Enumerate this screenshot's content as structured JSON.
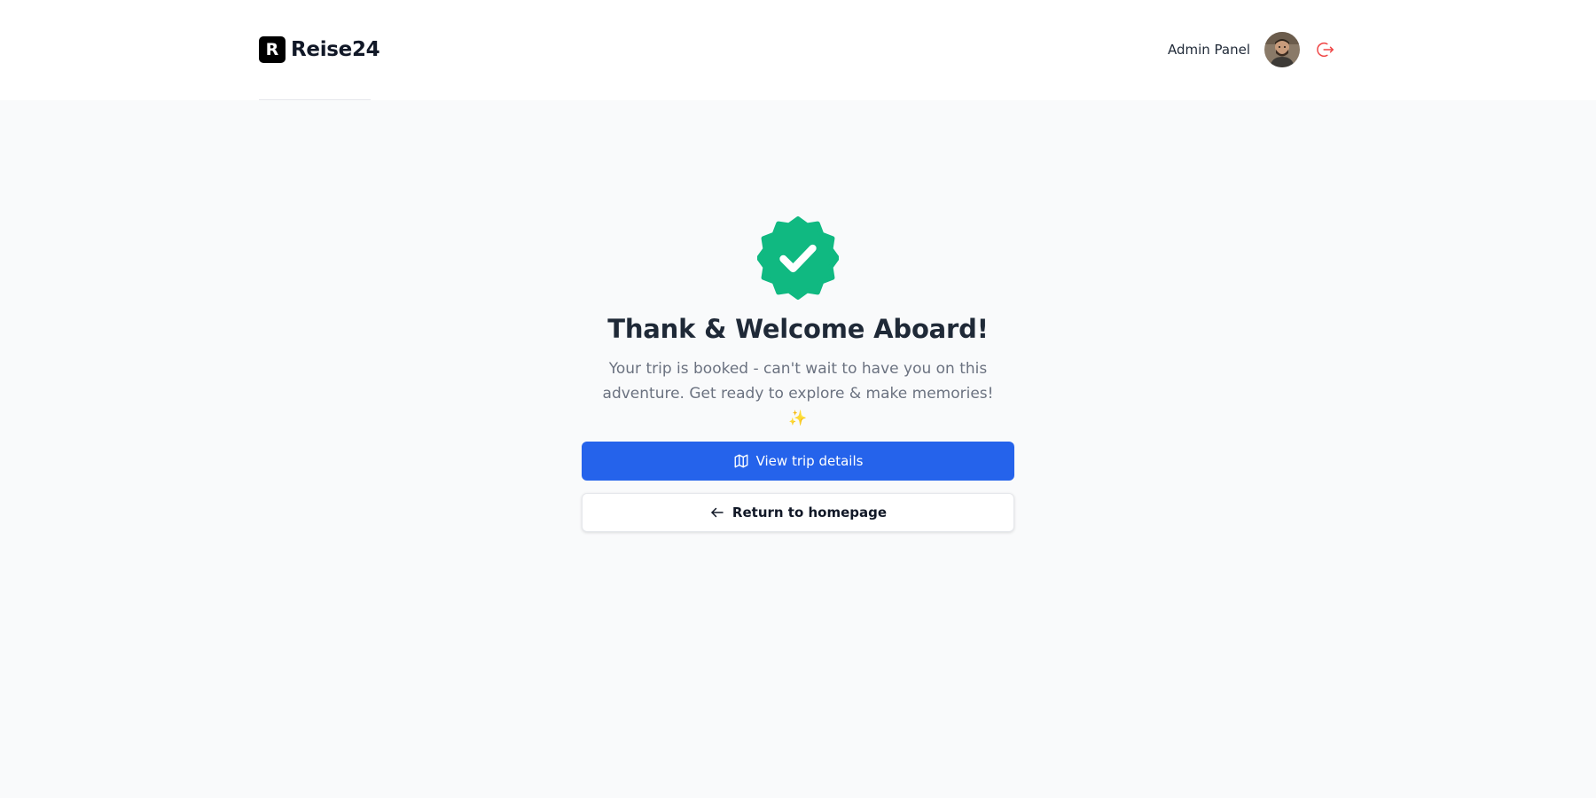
{
  "brand": {
    "mark": "R",
    "name": "Reise24"
  },
  "nav": {
    "admin_label": "Admin Panel",
    "avatar_icon": "user-avatar",
    "logout_icon": "logout-icon"
  },
  "confirmation": {
    "icon": "verified-badge-icon",
    "title": "Thank & Welcome Aboard!",
    "message": "Your trip is booked - can't wait to have you on this adventure. Get ready to explore & make memories! ✨",
    "primary_button": {
      "label": "View trip details",
      "icon": "map-icon"
    },
    "secondary_button": {
      "label": "Return to homepage",
      "icon": "arrow-left-icon"
    }
  },
  "colors": {
    "accent": "#2563eb",
    "success": "#10b981",
    "logout": "#ef4444",
    "background": "#f9fafb"
  }
}
